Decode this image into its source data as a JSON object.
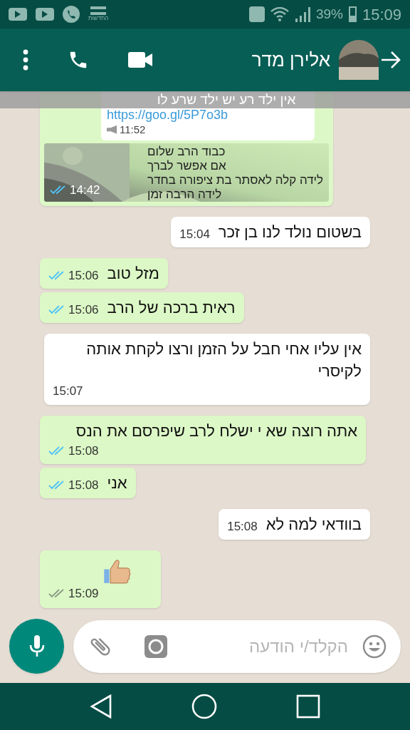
{
  "status_bar": {
    "news_label": "החדשות",
    "battery": "39%",
    "time": "15:09"
  },
  "header": {
    "contact_name": "אלירן מדר"
  },
  "notification_banner": {
    "text": "אין ילד רע יש ילד שרע לו"
  },
  "messages": [
    {
      "kind": "media",
      "outgoing": true,
      "forwarded": {
        "link": "https://goo.gl/5P7o3b",
        "time": "11:52"
      },
      "caption": [
        "כבוד הרב שלום",
        "אם אפשר לברך",
        "לידה קלה לאסתר בת ציפורה בחדר",
        "לידה הרבה זמן"
      ],
      "time": "14:42",
      "read": true
    },
    {
      "kind": "text",
      "outgoing": false,
      "text": "בשטום נולד לנו בן זכר",
      "time": "15:04"
    },
    {
      "kind": "text",
      "outgoing": true,
      "text": "מזל טוב",
      "time": "15:06",
      "read": true
    },
    {
      "kind": "text",
      "outgoing": true,
      "text": "ראית ברכה של הרב",
      "time": "15:06",
      "read": true
    },
    {
      "kind": "text",
      "outgoing": false,
      "text": "אין עליו אחי חבל על הזמן ורצו לקחת אותה לקיסרי",
      "time": "15:07"
    },
    {
      "kind": "text",
      "outgoing": true,
      "text": "אתה רוצה שא י ישלח לרב שיפרסם את הנס",
      "time": "15:08",
      "read": true
    },
    {
      "kind": "text",
      "outgoing": true,
      "text": "אני",
      "time": "15:08",
      "read": true
    },
    {
      "kind": "text",
      "outgoing": false,
      "text": "בוודאי למה לא",
      "time": "15:08"
    },
    {
      "kind": "thumbs_up",
      "outgoing": true,
      "time": "15:09",
      "read": false
    }
  ],
  "composer": {
    "placeholder": "הקלד/י הודעה"
  }
}
